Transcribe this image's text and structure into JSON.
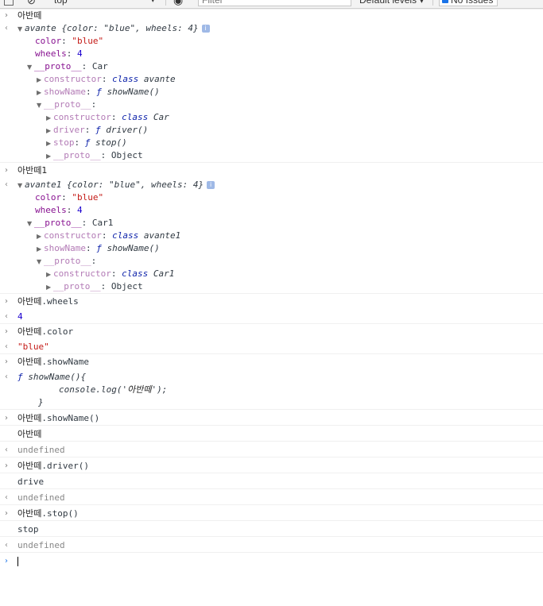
{
  "toolbar": {
    "context": "top",
    "filter_placeholder": "Filter",
    "levels": "Default levels ▾",
    "issues": "No Issues"
  },
  "entries": {
    "e1": {
      "input": "아반떼",
      "summary_name": "avante",
      "summary_body": "{color: \"blue\", wheels: 4}",
      "color_key": "color",
      "color_val": "\"blue\"",
      "wheels_key": "wheels",
      "wheels_val": "4",
      "proto_key": "__proto__",
      "proto_val": "Car",
      "constructor_key": "constructor",
      "constructor_kw": "class",
      "constructor_name": "avante",
      "showName_key": "showName",
      "showName_f": "ƒ",
      "showName_val": "showName()",
      "proto2_key": "__proto__",
      "c2_key": "constructor",
      "c2_kw": "class",
      "c2_name": "Car",
      "driver_key": "driver",
      "driver_f": "ƒ",
      "driver_val": "driver()",
      "stop_key": "stop",
      "stop_f": "ƒ",
      "stop_val": "stop()",
      "proto3_key": "__proto__",
      "proto3_val": "Object"
    },
    "e2": {
      "input": "아반떼1",
      "summary_name": "avante1",
      "summary_body": "{color: \"blue\", wheels: 4}",
      "color_key": "color",
      "color_val": "\"blue\"",
      "wheels_key": "wheels",
      "wheels_val": "4",
      "proto_key": "__proto__",
      "proto_val": "Car1",
      "constructor_key": "constructor",
      "constructor_kw": "class",
      "constructor_name": "avante1",
      "showName_key": "showName",
      "showName_f": "ƒ",
      "showName_val": "showName()",
      "proto2_key": "__proto__",
      "c2_key": "constructor",
      "c2_kw": "class",
      "c2_name": "Car1",
      "proto3_key": "__proto__",
      "proto3_val": "Object"
    },
    "e3": {
      "input_obj": "아반떼",
      "input_prop": ".wheels",
      "result": "4"
    },
    "e4": {
      "input_obj": "아반떼",
      "input_prop": ".color",
      "result": "\"blue\""
    },
    "e5": {
      "input_obj": "아반떼",
      "input_prop": ".showName",
      "f": "ƒ",
      "line1": "showName(){",
      "line2_a": "console.log('",
      "line2_kr": "아반떼",
      "line2_b": "');",
      "line3": "}"
    },
    "e6": {
      "input_obj": "아반떼",
      "input_prop": ".showName()",
      "log": "아반떼",
      "result": "undefined"
    },
    "e7": {
      "input_obj": "아반떼",
      "input_prop": ".driver()",
      "log": "drive",
      "result": "undefined"
    },
    "e8": {
      "input_obj": "아반떼",
      "input_prop": ".stop()",
      "log": "stop",
      "result": "undefined"
    }
  }
}
